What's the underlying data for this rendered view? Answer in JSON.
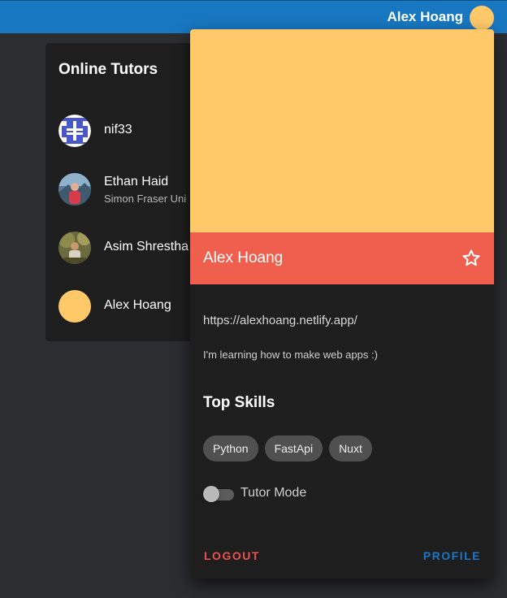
{
  "topbar": {
    "user_name": "Alex Hoang",
    "avatar_color": "#ffc96a",
    "bar_color": "#1877c1"
  },
  "tutors": {
    "title": "Online Tutors",
    "items": [
      {
        "name": "nif33",
        "subtitle": "",
        "avatar": "identicon-icon"
      },
      {
        "name": "Ethan Haid",
        "subtitle": "Simon Fraser Uni",
        "avatar": "photo-avatar"
      },
      {
        "name": "Asim Shrestha",
        "subtitle": "",
        "avatar": "photo-avatar"
      },
      {
        "name": "Alex Hoang",
        "subtitle": "",
        "avatar": "color-avatar"
      }
    ]
  },
  "profile": {
    "name": "Alex Hoang",
    "banner_color": "#ffc96a",
    "header_color": "#ef5f4d",
    "star_icon": "star-outline-icon",
    "website": "https://alexhoang.netlify.app/",
    "bio": "I'm learning how to make web apps :)",
    "skills_title": "Top Skills",
    "skills": [
      "Python",
      "FastApi",
      "Nuxt"
    ],
    "tutor_mode_label": "Tutor Mode",
    "tutor_mode_on": false,
    "logout_label": "LOGOUT",
    "profile_label": "PROFILE"
  }
}
